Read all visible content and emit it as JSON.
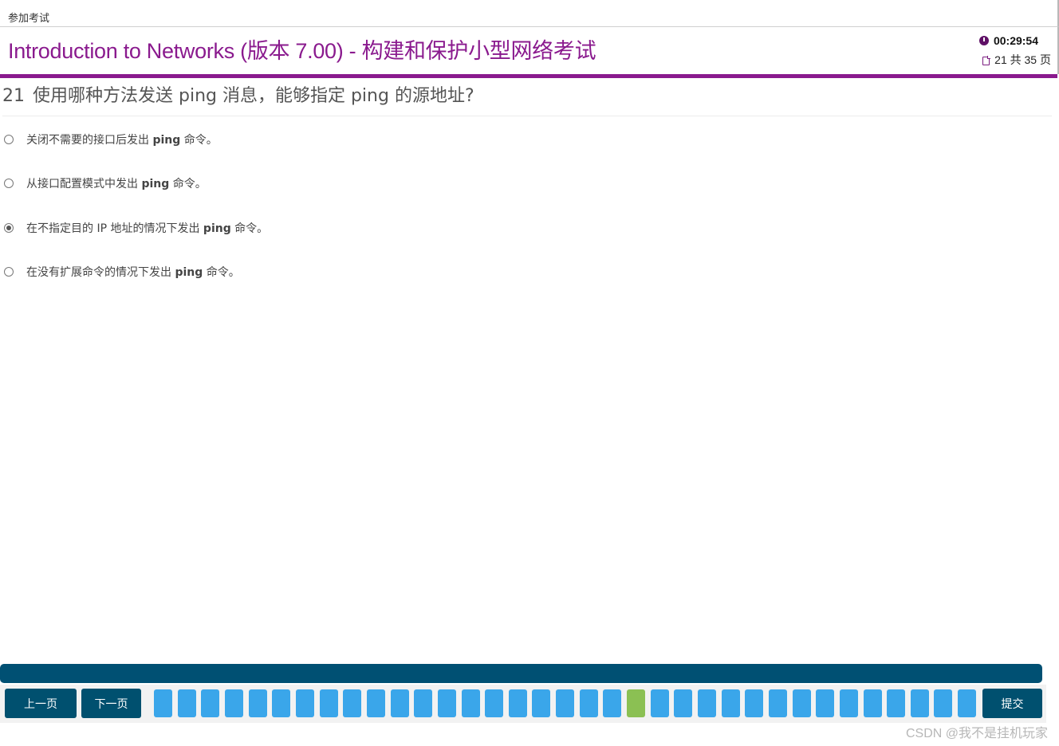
{
  "topbar": {
    "breadcrumb": "参加考试"
  },
  "header": {
    "title": "Introduction to Networks (版本 7.00) - 构建和保护小型网络考试",
    "timer": "00:29:54",
    "page_indicator": "21 共 35 页"
  },
  "question": {
    "number": "21",
    "text": "使用哪种方法发送 ping 消息，能够指定 ping 的源地址?",
    "options": [
      {
        "pre": "关闭不需要的接口后发出 ",
        "cmd": "ping",
        "post": " 命令。",
        "selected": false
      },
      {
        "pre": "从接口配置模式中发出 ",
        "cmd": "ping",
        "post": " 命令。",
        "selected": false
      },
      {
        "pre": "在不指定目的 IP 地址的情况下发出 ",
        "cmd": "ping",
        "post": " 命令。",
        "selected": true
      },
      {
        "pre": "在没有扩展命令的情况下发出 ",
        "cmd": "ping",
        "post": " 命令。",
        "selected": false
      }
    ]
  },
  "footer": {
    "prev_label": "上一页",
    "next_label": "下一页",
    "submit_label": "提交",
    "question_count": 35,
    "current_question": 21
  },
  "colors": {
    "brand_purple": "#8a1a8e",
    "nav_blue": "#00506f",
    "question_box": "#3aa6ea",
    "current_box": "#8bc053"
  },
  "watermark": "CSDN @我不是挂机玩家"
}
